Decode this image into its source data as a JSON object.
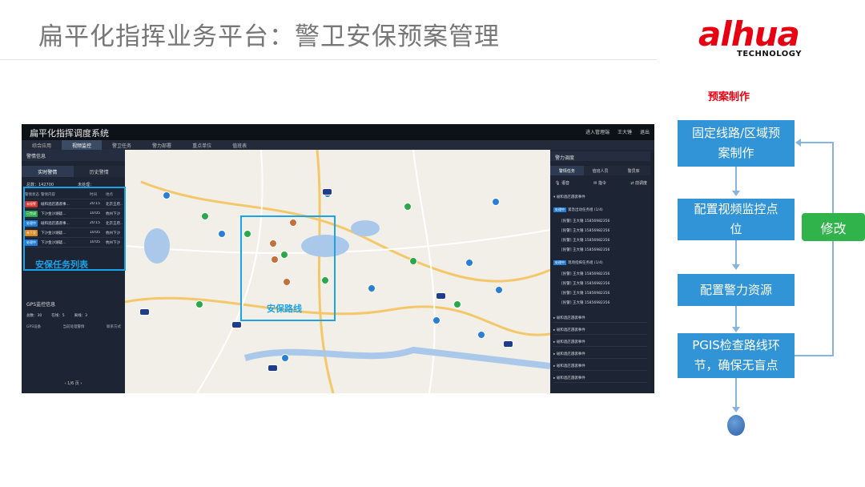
{
  "slide": {
    "title": "扁平化指挥业务平台：警卫安保预案管理",
    "logo": {
      "word": "alhua",
      "sub": "TECHNOLOGY"
    }
  },
  "platform": {
    "title": "扁平化指挥调度系统",
    "top_right": [
      "进入管理端",
      "王大锤",
      "退出"
    ],
    "nav": [
      "综合应用",
      "视频监控",
      "警卫任务",
      "警力部署",
      "重点单位",
      "值班表"
    ],
    "nav_active": 1,
    "left_panel": {
      "header": "警情信息",
      "tabs": [
        "实时警情",
        "历史警情"
      ],
      "stat_a": "总数：142700",
      "stat_b": "未处理：",
      "columns": [
        "警情状态",
        "警情内容",
        "时间",
        "地点"
      ],
      "rows": [
        {
          "status": "未接警",
          "status_color": "#d9342b",
          "content": "碰和酒店遇袭事...",
          "time": "20:15",
          "place": "北京王府..."
        },
        {
          "status": "已完成",
          "status_color": "#2aa84a",
          "content": "下沙金沙湖疑...",
          "time": "10:05",
          "place": "杭州下沙"
        },
        {
          "status": "处理中",
          "status_color": "#1f7fd8",
          "content": "碰和酒店遇袭事...",
          "time": "20:15",
          "place": "北京王府..."
        },
        {
          "status": "未下发",
          "status_color": "#e08a1e",
          "content": "下沙金沙湖疑...",
          "time": "10:05",
          "place": "杭州下沙"
        },
        {
          "status": "处理中",
          "status_color": "#1f7fd8",
          "content": "下沙金沙湖疑...",
          "time": "10:05",
          "place": "杭州下沙"
        }
      ],
      "annotation": "安保任务列表",
      "gps_title": "GPS监控信息",
      "gps_stats": [
        "总数：30",
        "在线：5",
        "离线：3"
      ],
      "gps_columns": [
        "GPS设备",
        "当前处理警情",
        "联系方式"
      ],
      "pager": "1/6 页"
    },
    "map": {
      "annotation": "安保路线"
    },
    "right_panel": {
      "header": "警力调度",
      "tabs": [
        "警情任务",
        "值班人员",
        "警员库"
      ],
      "actions": [
        "语音",
        "指令",
        "前调度"
      ],
      "group_title": "碰和酒店遇袭事件",
      "events": [
        {
          "tag": "处理中",
          "text": "紧急出动任务组 (1/4)"
        },
        {
          "tag": "处理中",
          "text": "现场指挥任务组 (1/4)"
        }
      ],
      "members": [
        {
          "role": "[民警]",
          "name": "王大锤",
          "phone": "15856982356"
        },
        {
          "role": "[民警]",
          "name": "王大锤",
          "phone": "15856982356"
        },
        {
          "role": "[民警]",
          "name": "王大锤",
          "phone": "15856982356"
        },
        {
          "role": "[民警]",
          "name": "王大锤",
          "phone": "15856982356"
        }
      ],
      "collapsed": [
        "碰和酒店遇袭事件",
        "碰和酒店遇袭事件",
        "碰和酒店遇袭事件",
        "碰和酒店遇袭事件",
        "碰和酒店遇袭事件",
        "碰和酒店遇袭事件"
      ]
    }
  },
  "flow": {
    "title": "预案制作",
    "steps": [
      {
        "line1": "固定线路/区域预",
        "line2": "案制作"
      },
      {
        "line1": "配置视频监控点",
        "line2": "位"
      },
      {
        "line1": "配置警力资源",
        "line2": ""
      },
      {
        "line1": "PGIS检查路线环",
        "line2": "节，确保无盲点"
      }
    ],
    "edit_label": "修改"
  }
}
